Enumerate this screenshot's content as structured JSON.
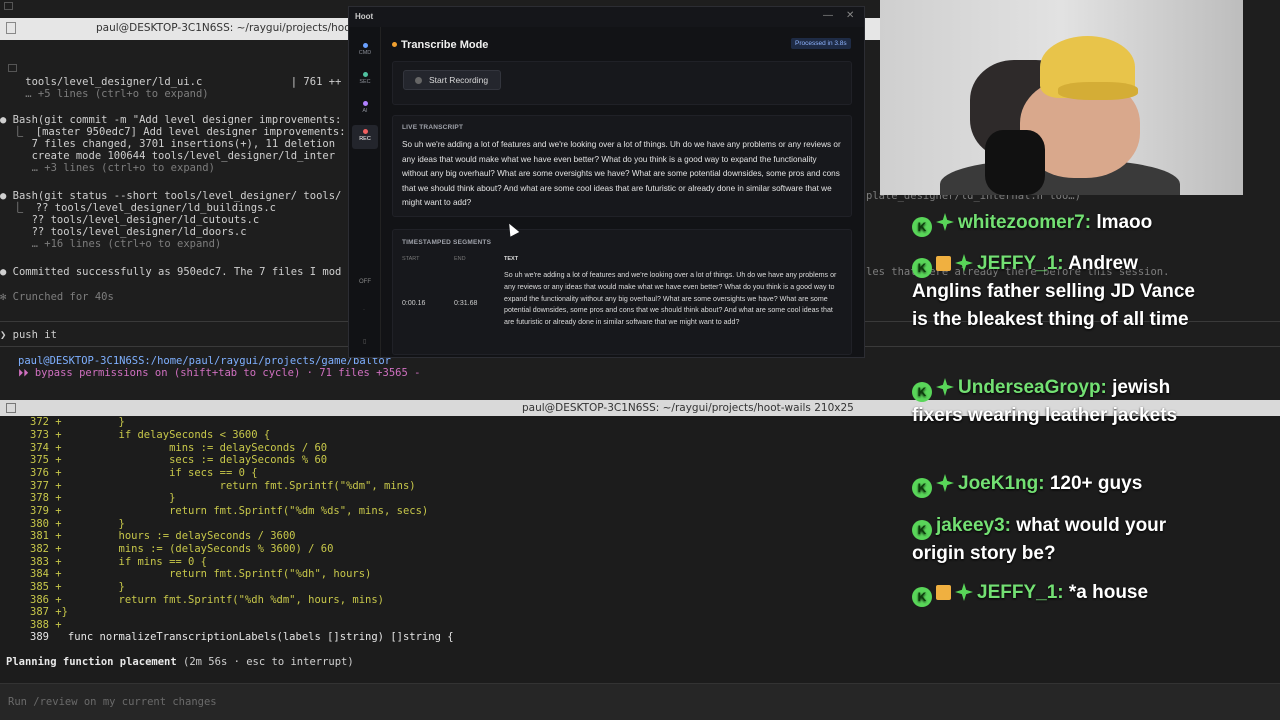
{
  "top_terminal": {
    "title": "paul@DESKTOP-3C1N6SS: ~/raygui/projects/hoot-wails",
    "lines": [
      "    tools/level_designer/ld_ui.c              | 761 ++",
      "    … +5 lines (ctrl+o to expand)",
      "● Bash(git commit -m \"Add level designer improvements:",
      "  ⎿  [master 950edc7] Add level designer improvements:",
      "     7 files changed, 3701 insertions(+), 11 deletion",
      "     create mode 100644 tools/level_designer/ld_inter",
      "     … +3 lines (ctrl+o to expand)",
      "● Bash(git status --short tools/level_designer/ tools/",
      "  ⎿  ?? tools/level_designer/ld_buildings.c",
      "     ?? tools/level_designer/ld_cutouts.c",
      "     ?? tools/level_designer/ld_doors.c",
      "     … +16 lines (ctrl+o to expand)",
      "● Committed successfully as 950edc7. The 7 files I mod",
      "✻ Crunched for 40s",
      "❯ push it",
      "paul@DESKTOP-3C1N6SS:/home/paul/raygui/projects/game/baltor",
      "⏵⏵ bypass permissions on (shift+tab to cycle) · 71 files +3565 -",
      "plate_designer/ld_internal.h too…)",
      "les that were already there before this session."
    ]
  },
  "bottom_terminal": {
    "title": "paul@DESKTOP-3C1N6SS: ~/raygui/projects/hoot-wails 210x25",
    "code_lines": [
      "372 +         }",
      "373 +         if delaySeconds < 3600 {",
      "374 +                 mins := delaySeconds / 60",
      "375 +                 secs := delaySeconds % 60",
      "376 +                 if secs == 0 {",
      "377 +                         return fmt.Sprintf(\"%dm\", mins)",
      "378 +                 }",
      "379 +                 return fmt.Sprintf(\"%dm %ds\", mins, secs)",
      "380 +         }",
      "381 +         hours := delaySeconds / 3600",
      "382 +         mins := (delaySeconds % 3600) / 60",
      "383 +         if mins == 0 {",
      "384 +                 return fmt.Sprintf(\"%dh\", hours)",
      "385 +         }",
      "386 +         return fmt.Sprintf(\"%dh %dm\", hours, mins)",
      "387 +}",
      "388 +",
      "389   func normalizeTranscriptionLabels(labels []string) []string {"
    ],
    "status_bold": "Planning function placement",
    "status_rest": " (2m 56s · esc to interrupt)",
    "input_placeholder": "Run /review on my current changes"
  },
  "hoot": {
    "app_name": "Hoot",
    "min_glyph": "—",
    "close_glyph": "✕",
    "rail": [
      {
        "label": "CMD",
        "color": "#6aa0ff"
      },
      {
        "label": "SEC",
        "color": "#4fc1a0"
      },
      {
        "label": "AI",
        "color": "#b080ff"
      },
      {
        "label": "REC",
        "color": "#f06060"
      }
    ],
    "rail_off": "OFF",
    "mode_title": "Transcribe Mode",
    "processed_badge": "Processed in 3.8s",
    "record_button": "Start Recording",
    "live_label": "LIVE TRANSCRIPT",
    "transcript": "So uh we're adding a lot of features and we're looking over a lot of things. Uh do we have any problems or any reviews or any ideas that would make what we have even better? What do you think is a good way to expand the functionality without any big overhaul? What are some oversights we have? What are some potential downsides, some pros and cons that we should think about? And what are some cool ideas that are futuristic or already done in similar software that we might want to add?",
    "segments_label": "TIMESTAMPED SEGMENTS",
    "columns": {
      "start": "START",
      "end": "END",
      "text": "TEXT"
    },
    "segment": {
      "start": "0:00.16",
      "end": "0:31.68",
      "text": "So uh we're adding a lot of features and we're looking over a lot of things. Uh do we have any problems or any reviews or any ideas that would make what we have even better? What do you think is a good way to expand the functionality without any big overhaul? What are some oversights we have? What are some potential downsides, some pros and cons that we should think about? And what are some cool ideas that are futuristic or already done in similar software that we might want to add?"
    }
  },
  "chat": [
    {
      "user": "whitezoomer7:",
      "text": "lmaoo",
      "gift": false
    },
    {
      "user": "JEFFY_1:",
      "text": "Andrew Anglins father selling JD Vance is the bleakest thing of all time",
      "gift": true
    },
    {
      "user": "UnderseaGroyp:",
      "text": "jewish fixers wearing leather jackets",
      "gift": false
    },
    {
      "user": "JoeK1ng:",
      "text": "120+ guys",
      "gift": false
    },
    {
      "user": "jakeey3:",
      "text": "what would your origin story be?",
      "gift": false
    },
    {
      "user": "JEFFY_1:",
      "text": "*a house",
      "gift": true
    }
  ],
  "chat_badge_glyph": "K",
  "colors": {
    "accent": "#f0a030",
    "chat_user": "#73e073",
    "diff_added": "#c8c84a"
  }
}
